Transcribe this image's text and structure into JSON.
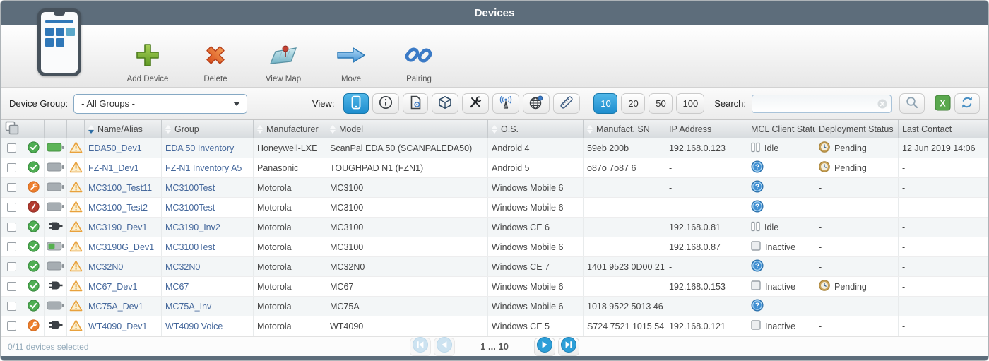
{
  "titlebar": {
    "title": "Devices"
  },
  "toolbar": {
    "buttons": [
      {
        "id": "add-device",
        "label": "Add Device"
      },
      {
        "id": "delete",
        "label": "Delete"
      },
      {
        "id": "view-map",
        "label": "View Map"
      },
      {
        "id": "move",
        "label": "Move"
      },
      {
        "id": "pairing",
        "label": "Pairing"
      }
    ]
  },
  "filter": {
    "device_group_label": "Device Group:",
    "device_group_value": "- All Groups -",
    "view_label": "View:",
    "view_buttons": [
      {
        "id": "device-view",
        "active": true
      },
      {
        "id": "info-view",
        "active": false
      },
      {
        "id": "file-view",
        "active": false
      },
      {
        "id": "software-view",
        "active": false
      },
      {
        "id": "tools-view",
        "active": false
      },
      {
        "id": "wireless-view",
        "active": false
      },
      {
        "id": "location-view",
        "active": false
      },
      {
        "id": "measure-view",
        "active": false
      }
    ],
    "page_sizes": [
      {
        "label": "10",
        "active": true
      },
      {
        "label": "20",
        "active": false
      },
      {
        "label": "50",
        "active": false
      },
      {
        "label": "100",
        "active": false
      }
    ],
    "search_label": "Search:",
    "search_value": ""
  },
  "table": {
    "columns": [
      {
        "label": "Name/Alias",
        "sortable": true,
        "sort": "desc"
      },
      {
        "label": "Group",
        "sortable": true,
        "sort": ""
      },
      {
        "label": "Manufacturer",
        "sortable": true,
        "sort": ""
      },
      {
        "label": "Model",
        "sortable": true,
        "sort": ""
      },
      {
        "label": "O.S.",
        "sortable": true,
        "sort": ""
      },
      {
        "label": "Manufact. SN",
        "sortable": true,
        "sort": ""
      },
      {
        "label": "IP Address",
        "sortable": false,
        "sort": ""
      },
      {
        "label": "MCL Client Status",
        "sortable": false,
        "sort": ""
      },
      {
        "label": "Deployment Status",
        "sortable": false,
        "sort": ""
      },
      {
        "label": "Last Contact",
        "sortable": false,
        "sort": ""
      }
    ],
    "rows": [
      {
        "status": "online",
        "power": "battery-full",
        "warning": true,
        "name": "EDA50_Dev1",
        "group": "EDA 50 Inventory",
        "manufacturer": "Honeywell-LXE",
        "model": "ScanPal EDA 50 (SCANPALEDA50)",
        "os": "Android 4",
        "sn": "59eb 200b",
        "ip": "192.168.0.123",
        "mcl_icon": "idle",
        "mcl_label": "Idle",
        "deploy_icon": "pending",
        "deploy_label": "Pending",
        "last_contact": "12 Jun 2019 14:06"
      },
      {
        "status": "online",
        "power": "battery",
        "warning": true,
        "name": "FZ-N1_Dev1",
        "group": "FZ-N1 Inventory A5",
        "manufacturer": "Panasonic",
        "model": "TOUGHPAD N1 (FZN1)",
        "os": "Android 5",
        "sn": "o87o 7o87 6",
        "ip": "-",
        "mcl_icon": "unknown",
        "mcl_label": "",
        "deploy_icon": "pending",
        "deploy_label": "Pending",
        "last_contact": "-"
      },
      {
        "status": "maintenance",
        "power": "battery",
        "warning": true,
        "name": "MC3100_Test11",
        "group": "MC3100Test",
        "manufacturer": "Motorola",
        "model": "MC3100",
        "os": "Windows Mobile 6",
        "sn": "",
        "ip": "-",
        "mcl_icon": "unknown",
        "mcl_label": "",
        "deploy_icon": "",
        "deploy_label": "-",
        "last_contact": "-"
      },
      {
        "status": "error",
        "power": "battery",
        "warning": true,
        "name": "MC3100_Test2",
        "group": "MC3100Test",
        "manufacturer": "Motorola",
        "model": "MC3100",
        "os": "Windows Mobile 6",
        "sn": "",
        "ip": "-",
        "mcl_icon": "unknown",
        "mcl_label": "",
        "deploy_icon": "",
        "deploy_label": "-",
        "last_contact": "-"
      },
      {
        "status": "online",
        "power": "plug",
        "warning": true,
        "name": "MC3190_Dev1",
        "group": "MC3190_Inv2",
        "manufacturer": "Motorola",
        "model": "MC3100",
        "os": "Windows CE 6",
        "sn": "",
        "ip": "192.168.0.81",
        "mcl_icon": "idle",
        "mcl_label": "Idle",
        "deploy_icon": "",
        "deploy_label": "-",
        "last_contact": "-"
      },
      {
        "status": "online",
        "power": "battery-half",
        "warning": true,
        "name": "MC3190G_Dev1",
        "group": "MC3100Test",
        "manufacturer": "Motorola",
        "model": "MC3100",
        "os": "Windows Mobile 6",
        "sn": "",
        "ip": "192.168.0.87",
        "mcl_icon": "inactive",
        "mcl_label": "Inactive",
        "deploy_icon": "",
        "deploy_label": "-",
        "last_contact": "-"
      },
      {
        "status": "online",
        "power": "battery",
        "warning": true,
        "name": "MC32N0",
        "group": "MC32N0",
        "manufacturer": "Motorola",
        "model": "MC32N0",
        "os": "Windows CE 7",
        "sn": "1401 9523 0D00 21",
        "ip": "-",
        "mcl_icon": "unknown",
        "mcl_label": "",
        "deploy_icon": "",
        "deploy_label": "-",
        "last_contact": "-"
      },
      {
        "status": "online",
        "power": "plug",
        "warning": true,
        "name": "MC67_Dev1",
        "group": "MC67",
        "manufacturer": "Motorola",
        "model": "MC67",
        "os": "Windows Mobile 6",
        "sn": "",
        "ip": "192.168.0.153",
        "mcl_icon": "inactive",
        "mcl_label": "Inactive",
        "deploy_icon": "pending",
        "deploy_label": "Pending",
        "last_contact": "-"
      },
      {
        "status": "online",
        "power": "battery",
        "warning": true,
        "name": "MC75A_Dev1",
        "group": "MC75A_Inv",
        "manufacturer": "Motorola",
        "model": "MC75A",
        "os": "Windows Mobile 6",
        "sn": "1018 9522 5013 46",
        "ip": "-",
        "mcl_icon": "unknown",
        "mcl_label": "",
        "deploy_icon": "",
        "deploy_label": "-",
        "last_contact": "-"
      },
      {
        "status": "maintenance",
        "power": "plug",
        "warning": true,
        "name": "WT4090_Dev1",
        "group": "WT4090 Voice",
        "manufacturer": "Motorola",
        "model": "WT4090",
        "os": "Windows CE 5",
        "sn": "S724 7521 1015 54",
        "ip": "192.168.0.121",
        "mcl_icon": "inactive",
        "mcl_label": "Inactive",
        "deploy_icon": "",
        "deploy_label": "-",
        "last_contact": "-"
      }
    ]
  },
  "footer": {
    "selection_text": "0/11 devices selected",
    "page_label": "1 ... 10",
    "pager": [
      {
        "id": "first-page",
        "enabled": false
      },
      {
        "id": "prev-page",
        "enabled": false
      },
      {
        "id": "next-page",
        "enabled": true
      },
      {
        "id": "last-page",
        "enabled": true
      }
    ]
  },
  "colors": {
    "titlebar": "#5d6d7b",
    "accent_blue": "#2d9fd8",
    "link": "#44679b",
    "online_green": "#4fae53",
    "maintenance_orange": "#ee7f2e",
    "error_red": "#b23b30",
    "warning_gold": "#e8a13c",
    "excel_green": "#5aa84e"
  }
}
